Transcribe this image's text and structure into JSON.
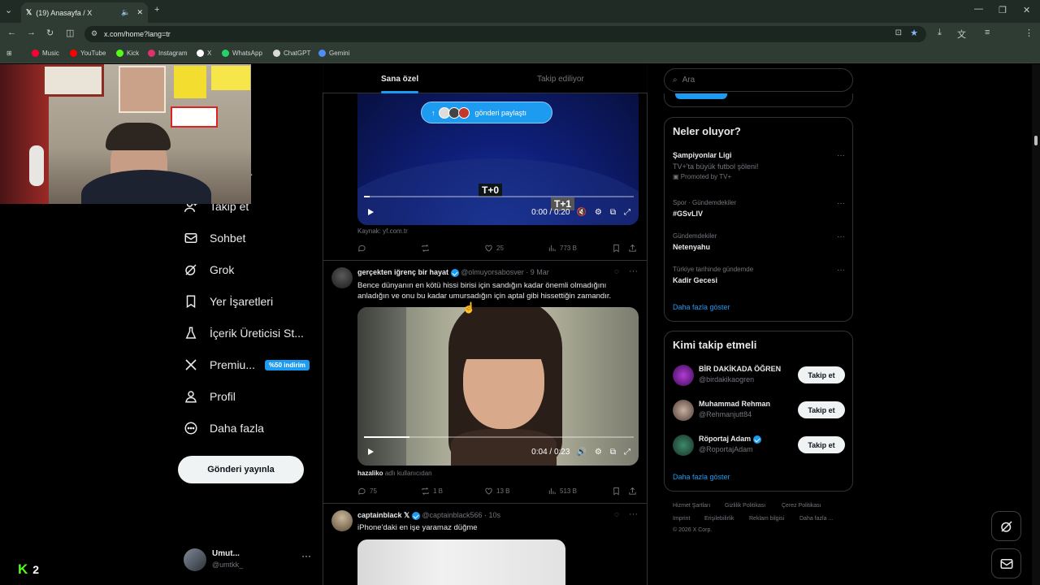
{
  "browser": {
    "tab_title": "(19) Anasayfa / X",
    "url": "x.com/home?lang=tr",
    "bookmarks": [
      {
        "label": "Music",
        "color": "#ff0033"
      },
      {
        "label": "YouTube",
        "color": "#ff0000"
      },
      {
        "label": "Kick",
        "color": "#53fc18"
      },
      {
        "label": "Instagram",
        "color": "#e1306c"
      },
      {
        "label": "X",
        "color": "#ffffff"
      },
      {
        "label": "WhatsApp",
        "color": "#25d366"
      },
      {
        "label": "ChatGPT",
        "color": "#d9d9d9"
      },
      {
        "label": "Gemini",
        "color": "#4f8ef7"
      }
    ]
  },
  "sidebar": {
    "partial_home": "a",
    "partial_second": "er",
    "items": [
      {
        "label": "Takip et",
        "icon": "add-user-icon"
      },
      {
        "label": "Sohbet",
        "icon": "mail-icon"
      },
      {
        "label": "Grok",
        "icon": "grok-icon"
      },
      {
        "label": "Yer İşaretleri",
        "icon": "bookmark-icon"
      },
      {
        "label": "İçerik Üreticisi St...",
        "icon": "flask-icon"
      },
      {
        "label": "Premiu...",
        "icon": "x-logo-icon"
      },
      {
        "label": "Profil",
        "icon": "person-icon"
      },
      {
        "label": "Daha fazla",
        "icon": "more-circle-icon"
      }
    ],
    "premium_badge": "%50 indirim",
    "post_button": "Gönderi yayınla",
    "user": {
      "name": "Umut...",
      "handle": "@umtkk_"
    }
  },
  "kick_overlay": {
    "count": "2"
  },
  "feed": {
    "tabs": [
      "Sana özel",
      "Takip ediliyor"
    ],
    "share_pill": "gönderi paylaştı",
    "tweet1": {
      "time": "0:00 / 0:20",
      "overlay_labels": [
        "T+0",
        "T+1"
      ],
      "source": "Kaynak: yf.com.tr",
      "likes": "25",
      "views": "773 B"
    },
    "tweet2": {
      "name": "gerçekten iğrenç bir hayat",
      "handle": "@olmuyorsabosver",
      "date": "· 9 Mar",
      "text_line1": "Bence dünyanın en kötü hissi birisi için sandığın kadar önemli olmadığını",
      "text_line2": "anladığın ve onu bu kadar umursadığın için aptal gibi hissettiğin zamandır.",
      "time": "0:04 / 0:23",
      "progress": 0.17,
      "credit_user": "hazaliko",
      "credit_text": "adlı kullanıcıdan",
      "replies": "75",
      "reposts": "1 B",
      "likes": "13 B",
      "views": "513 B"
    },
    "tweet3": {
      "name": "captainblack",
      "handle": "@captainblack566",
      "date": "· 10s",
      "text": "iPhone'daki en işe yaramaz düğme"
    }
  },
  "right": {
    "search_placeholder": "Ara",
    "trends_title": "Neler oluyor?",
    "trends": [
      {
        "meta": "",
        "name": "Şampiyonlar Ligi",
        "sub": "TV+'ta büyük futbol şöleni!",
        "promo": "Promoted by TV+"
      },
      {
        "meta": "Spor · Gündemdekiler",
        "name": "#GSvLIV"
      },
      {
        "meta": "Gündemdekiler",
        "name": "Netenyahu"
      },
      {
        "meta": "Türkiye tarihinde gündemde",
        "name": "Kadir Gecesi"
      }
    ],
    "show_more": "Daha fazla göster",
    "follow_title": "Kimi takip etmeli",
    "follow": [
      {
        "name": "BİR DAKİKADA ÖĞREN",
        "handle": "@birdakikaogren",
        "btn": "Takip et"
      },
      {
        "name": "Muhammad Rehman",
        "handle": "@Rehmanjutt84",
        "btn": "Takip et"
      },
      {
        "name": "Röportaj Adam",
        "handle": "@RoportajAdam",
        "btn": "Takip et"
      }
    ],
    "footer": [
      "Hizmet Şartları",
      "Gizlilik Politikası",
      "Çerez Politikası",
      "Imprint",
      "Erişilebilirlik",
      "Reklam bilgisi",
      "Daha fazla ...",
      "© 2026 X Corp."
    ]
  }
}
